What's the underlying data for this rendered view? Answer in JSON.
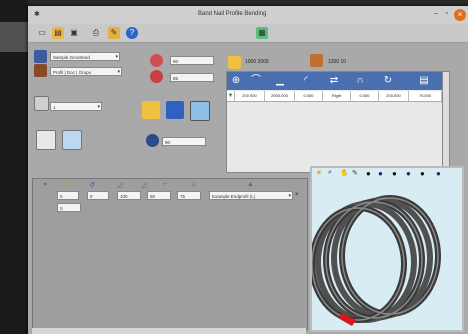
{
  "window": {
    "title": "Band Nail Profile Bending"
  },
  "toolbar": {
    "items": [
      "new-icon",
      "open-icon",
      "save-icon",
      "print-icon",
      "settings-icon",
      "help-icon",
      "export-icon"
    ]
  },
  "left_controls": {
    "material_select": "Sample Grootrend",
    "profile_select": "Profil | Doc | Grupo",
    "small_select": "1",
    "value_top": "90",
    "value_mid": "85",
    "value_angle": "90"
  },
  "grid": {
    "tab1": "1000 2000",
    "tab2": "1200 10",
    "cells": [
      "200 000",
      "2000.000",
      "0.000",
      "Right",
      "0.000",
      "200.000",
      "75.000"
    ]
  },
  "param_row": {
    "inputs": [
      "0",
      "0",
      "100",
      "90",
      "75"
    ],
    "dropdown": "Example Endprofil (L)",
    "extra": "0"
  },
  "colors": {
    "window_bg": "#a9a9a9",
    "grid_header": "#4a6fb0",
    "viewport_bg": "#d8ecf4",
    "close_button": "#e07020"
  }
}
